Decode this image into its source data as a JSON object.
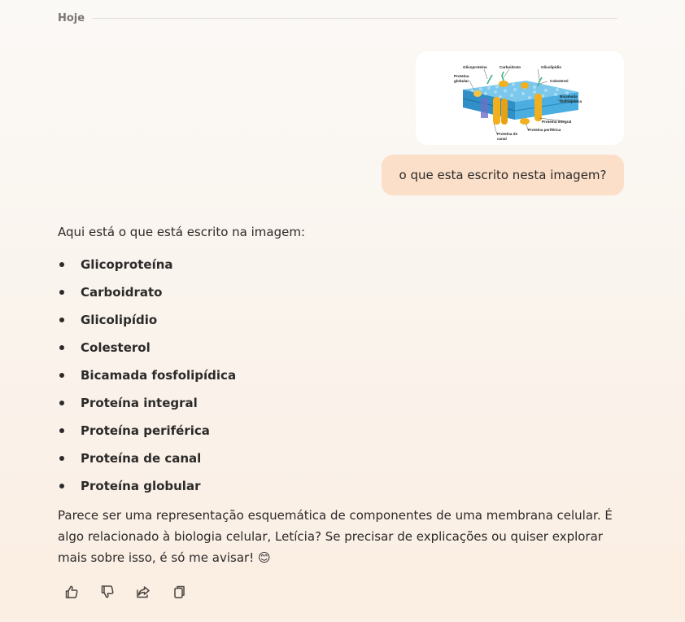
{
  "chat": {
    "date_label": "Hoje",
    "user_message": "o que esta escrito nesta imagem?",
    "image_labels": {
      "glicoproteina": "Glicoproteína",
      "carboidrato": "Carboidrato",
      "glicolipidio": "Glicolipídio",
      "proteina_globular_1": "Proteína",
      "proteina_globular_2": "globular",
      "colesterol": "Colesterol",
      "bicamada_1": "Bicamada",
      "bicamada_2": "fosfolipídica",
      "proteina_integral": "Proteína integral",
      "proteina_periferica": "Proteína periférica",
      "proteina_canal_1": "Proteína de",
      "proteina_canal_2": "canal"
    },
    "assistant": {
      "intro": "Aqui está o que está escrito na imagem:",
      "items": [
        "Glicoproteína",
        "Carboidrato",
        "Glicolipídio",
        "Colesterol",
        "Bicamada fosfolipídica",
        "Proteína integral",
        "Proteína periférica",
        "Proteína de canal",
        "Proteína globular"
      ],
      "outro": "Parece ser uma representação esquemática de componentes de uma membrana celular. É algo relacionado à biologia celular, Letícia? Se precisar de explicações ou quiser explorar mais sobre isso, é só me avisar! 😊"
    },
    "actions": [
      "thumbs-up-icon",
      "thumbs-down-icon",
      "share-icon",
      "copy-icon"
    ]
  },
  "colors": {
    "user_bubble": "#fbdfc9",
    "membrane": "#3aa3d9",
    "protein": "#f2b01e"
  }
}
